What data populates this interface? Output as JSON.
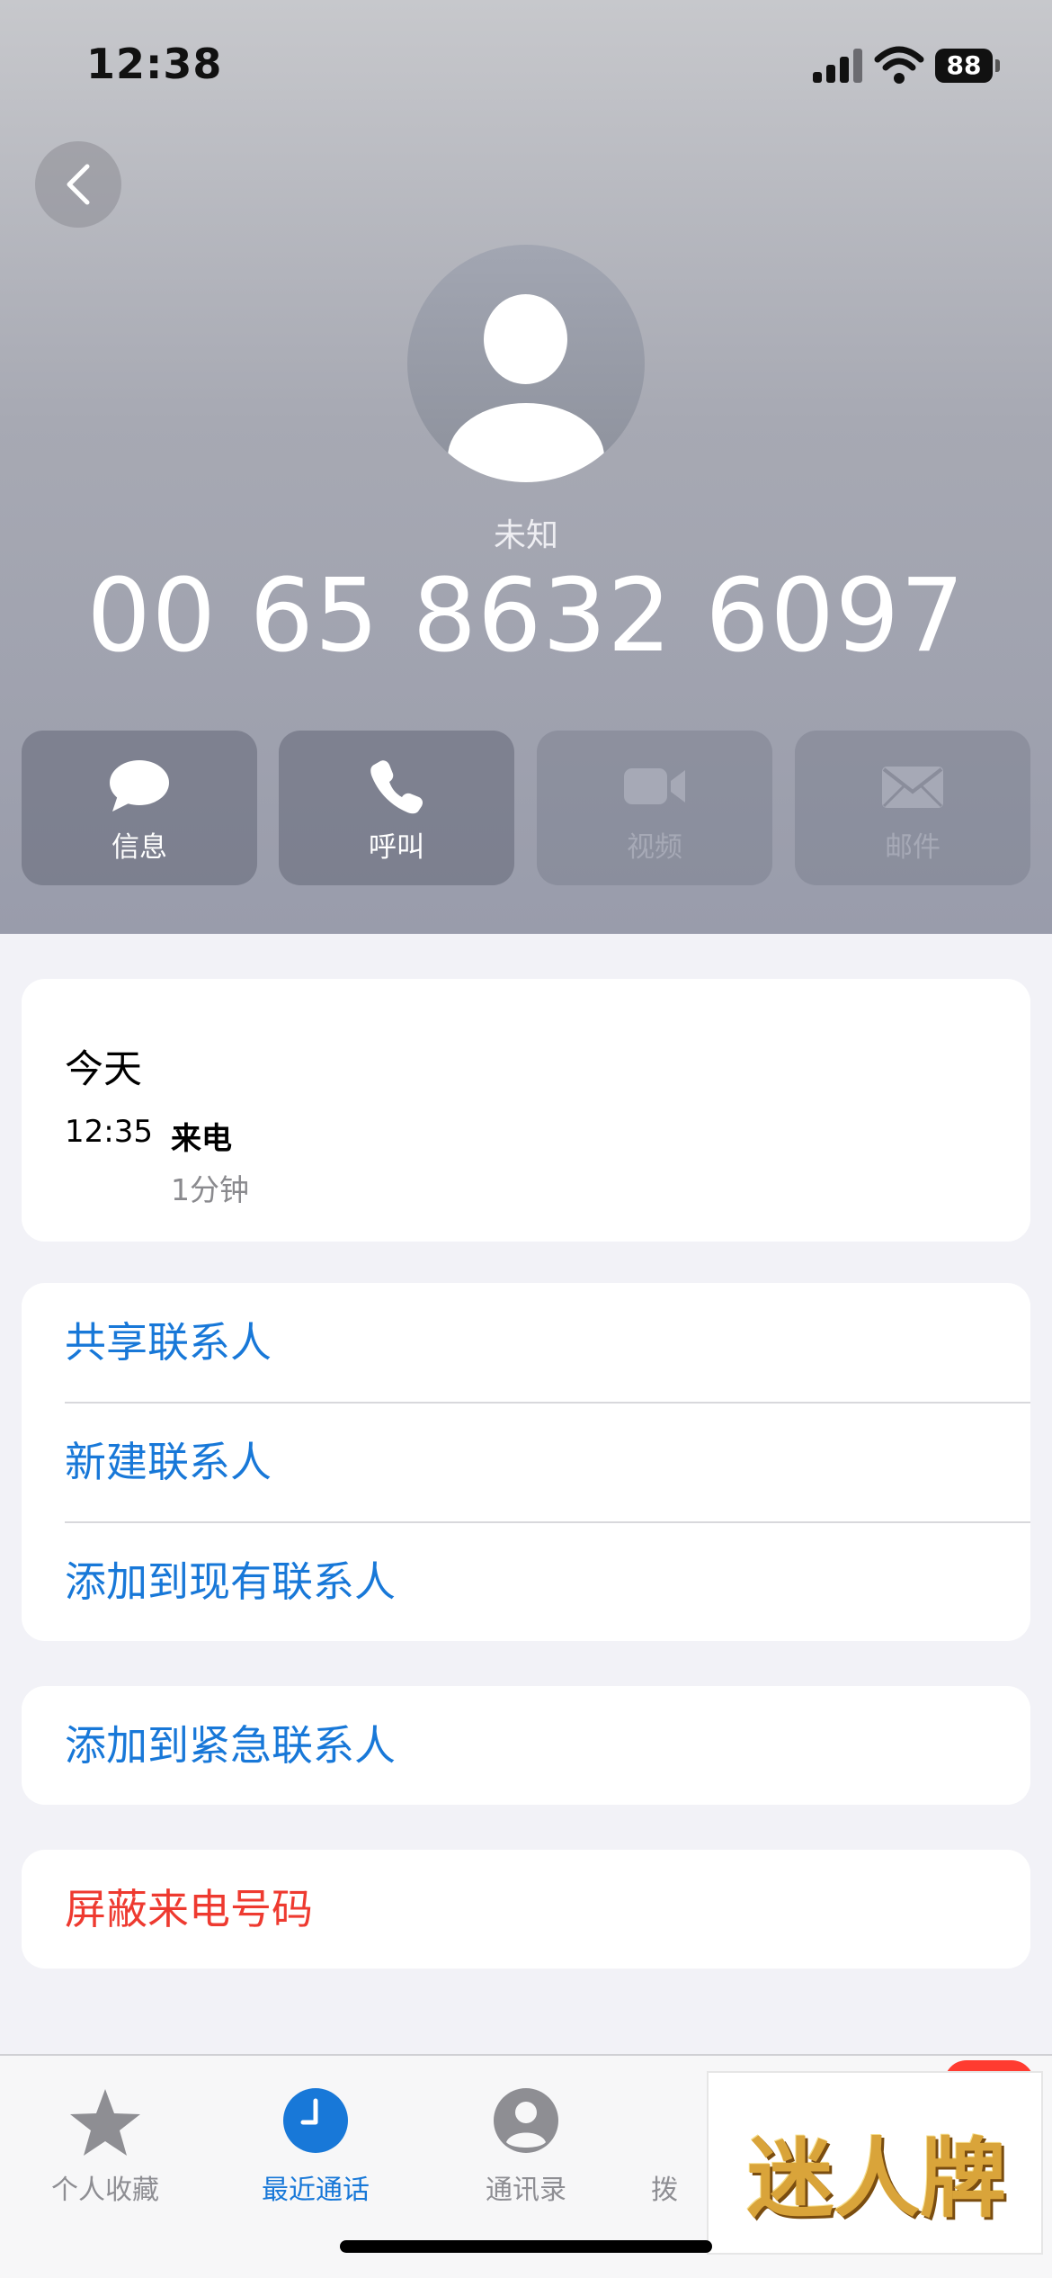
{
  "status_bar": {
    "time": "12:38",
    "battery": "88"
  },
  "header": {
    "caller_label": "未知",
    "caller_number": "00 65 8632 6097"
  },
  "actions": [
    {
      "label": "信息",
      "icon": "message-bubble-icon",
      "enabled": true
    },
    {
      "label": "呼叫",
      "icon": "phone-icon",
      "enabled": true
    },
    {
      "label": "视频",
      "icon": "video-camera-icon",
      "enabled": false
    },
    {
      "label": "邮件",
      "icon": "envelope-icon",
      "enabled": false
    }
  ],
  "history": {
    "date": "今天",
    "time": "12:35",
    "type": "来电",
    "duration": "1分钟"
  },
  "contact_options": [
    "共享联系人",
    "新建联系人",
    "添加到现有联系人"
  ],
  "emergency": "添加到紧急联系人",
  "block": "屏蔽来电号码",
  "tabs": [
    {
      "label": "个人收藏",
      "icon": "star-icon",
      "active": false
    },
    {
      "label": "最近通话",
      "icon": "clock-icon",
      "active": true
    },
    {
      "label": "通讯录",
      "icon": "person-circle-icon",
      "active": false
    },
    {
      "label": "拨",
      "icon": "keypad-icon",
      "active": false
    }
  ],
  "overlay": {
    "text": "迷人牌"
  },
  "colors": {
    "link": "#1878d8",
    "danger": "#ee3a30",
    "badge": "#ff3b30"
  }
}
